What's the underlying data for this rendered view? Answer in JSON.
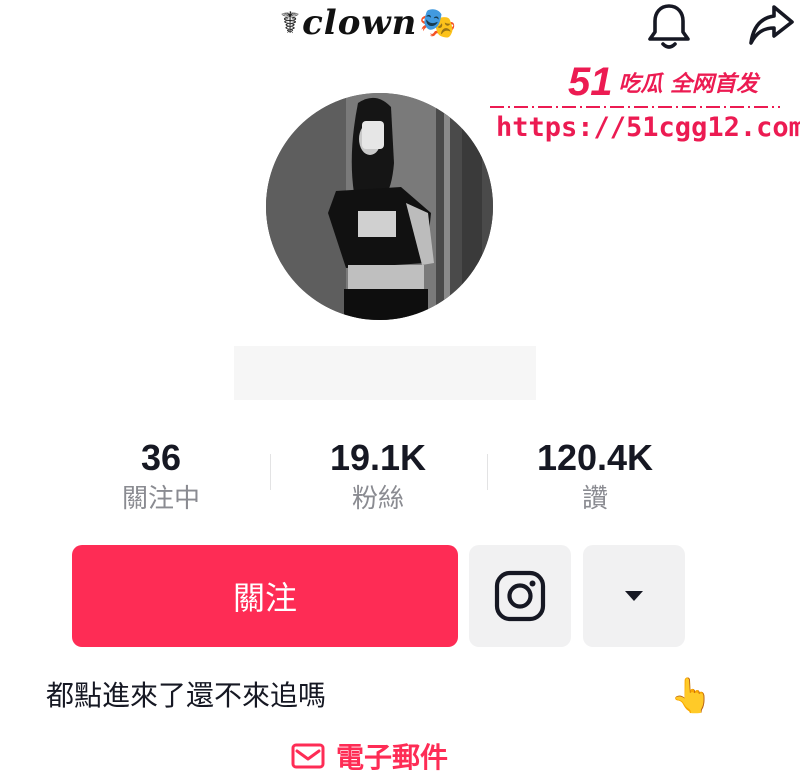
{
  "header": {
    "title_glyph": "☤",
    "title": "clown",
    "title_emoji": "🎭",
    "icons": [
      "bell-icon",
      "share-icon"
    ]
  },
  "watermark": {
    "number": "51",
    "tagline": "吃瓜 全网首发",
    "url": "https://51cgg12.com",
    "color": "#ec1b52"
  },
  "stats": [
    {
      "value": "36",
      "label": "關注中"
    },
    {
      "value": "19.1K",
      "label": "粉絲"
    },
    {
      "value": "120.4K",
      "label": "讚"
    }
  ],
  "actions": {
    "follow_label": "關注",
    "follow_color": "#fe2c55",
    "instagram_icon": "instagram-icon",
    "more_icon": "caret-down-icon"
  },
  "bio": {
    "text": "都點進來了還不來追嗎",
    "emoji": "👆"
  },
  "email": {
    "label": "電子郵件",
    "icon": "mail-icon"
  }
}
